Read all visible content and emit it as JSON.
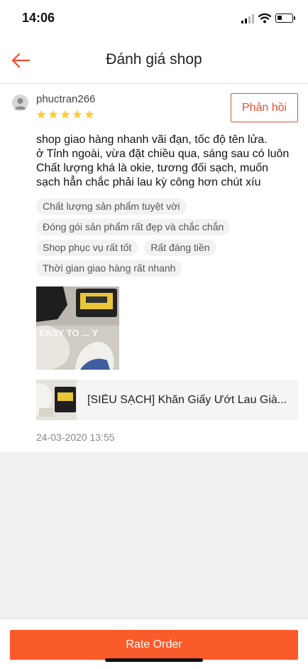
{
  "status_bar": {
    "time": "14:06"
  },
  "nav": {
    "title": "Đánh giá shop"
  },
  "review": {
    "username": "phuctran266",
    "rating": 5,
    "reply_label": "Phản hồi",
    "comment_lines": [
      "shop giao hàng nhanh vãi đạn, tốc độ tên lửa.",
      "ở Tỉnh ngoài, vừa đặt chiều qua, sáng sau có luôn",
      "Chất lượng khá là okie, tương đối sạch, muốn",
      "sạch hẳn chắc phải lau kỳ công hơn chút xíu"
    ],
    "tags": [
      "Chất lượng sản phẩm tuyệt vời",
      "Đóng gói sản phẩm rất đẹp và chắc chắn",
      "Shop phục vụ rất tốt",
      "Rất đáng tiền",
      "Thời gian giao hàng rất nhanh"
    ],
    "photo_text": "EASY TO ... Y",
    "product_name": "[SIÊU SẠCH] Khăn Giấy Ướt Lau Già...",
    "timestamp": "24-03-2020 13:55"
  },
  "footer": {
    "rate_label": "Rate Order"
  },
  "colors": {
    "accent": "#ee4d2d",
    "button": "#fb5a2a",
    "star": "#ffce3d"
  }
}
